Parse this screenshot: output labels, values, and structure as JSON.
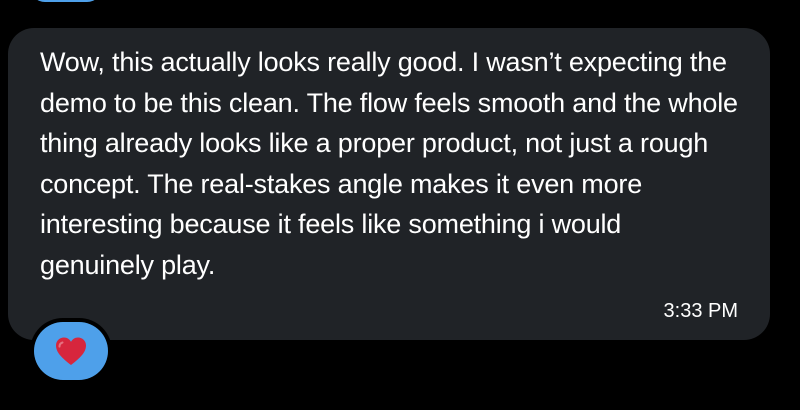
{
  "message": {
    "text": "Wow, this actually looks really good. I wasn’t expecting the demo to be this clean. The flow feels smooth and the whole thing already looks like a proper product, not just a rough concept. The real-stakes angle makes it even more interesting because it feels like something i would genuinely play.",
    "timestamp": "3:33 PM",
    "reaction_icon": "heart-icon"
  },
  "colors": {
    "background": "#000000",
    "bubble": "#202327",
    "text": "#ffffff",
    "reaction_pill": "#4ea0ea",
    "heart": "#d7263d"
  }
}
